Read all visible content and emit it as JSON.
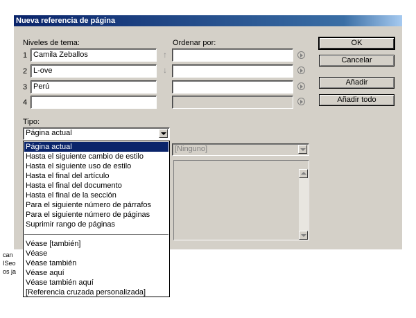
{
  "window": {
    "title": "Nueva referencia de página"
  },
  "levels": {
    "label": "Niveles de tema:",
    "rows": [
      {
        "number": "1",
        "value": "Camila Zeballos"
      },
      {
        "number": "2",
        "value": "L-ove"
      },
      {
        "number": "3",
        "value": "Perú"
      },
      {
        "number": "4",
        "value": ""
      }
    ]
  },
  "sort": {
    "label": "Ordenar por:"
  },
  "buttons": {
    "ok": "OK",
    "cancel": "Cancelar",
    "add": "Añadir",
    "add_all": "Añadir todo"
  },
  "type": {
    "label": "Tipo:",
    "selected": "Página actual",
    "options_group1": [
      "Página actual",
      "Hasta el siguiente cambio de estilo",
      "Hasta el siguiente uso de estilo",
      "Hasta el final del artículo",
      "Hasta el final del documento",
      "Hasta el final de la sección",
      "Para el siguiente número de párrafos",
      "Para el siguiente número de páginas",
      "Suprimir rango de páginas"
    ],
    "options_group2": [
      "Véase [también]",
      "Véase",
      "Véase también",
      "Véase aquí",
      "Véase también aquí",
      "[Referencia cruzada personalizada]"
    ]
  },
  "style_combo": {
    "value": "[Ninguno]"
  },
  "background_fragments": [
    "can",
    "ISeo",
    "os ja"
  ]
}
